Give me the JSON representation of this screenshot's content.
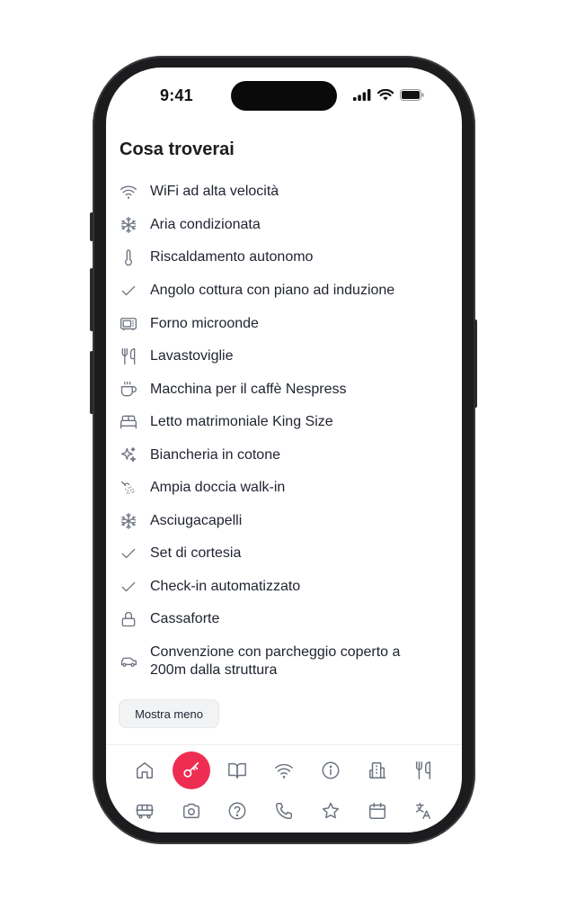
{
  "status_bar": {
    "time": "9:41"
  },
  "section": {
    "title": "Cosa troverai",
    "amenities": [
      {
        "icon": "wifi-icon",
        "label": "WiFi ad alta velocità"
      },
      {
        "icon": "snowflake-icon",
        "label": "Aria condizionata"
      },
      {
        "icon": "thermometer-icon",
        "label": "Riscaldamento autonomo"
      },
      {
        "icon": "check-icon",
        "label": "Angolo cottura con piano ad induzione"
      },
      {
        "icon": "microwave-icon",
        "label": "Forno microonde"
      },
      {
        "icon": "utensils-icon",
        "label": "Lavastoviglie"
      },
      {
        "icon": "coffee-cup-icon",
        "label": "Macchina per il caffè Nespress"
      },
      {
        "icon": "bed-icon",
        "label": "Letto matrimoniale King Size"
      },
      {
        "icon": "sparkles-icon",
        "label": "Biancheria in cotone"
      },
      {
        "icon": "shower-icon",
        "label": "Ampia doccia walk-in"
      },
      {
        "icon": "snowflake-icon",
        "label": "Asciugacapelli"
      },
      {
        "icon": "check-icon",
        "label": "Set di cortesia"
      },
      {
        "icon": "check-icon",
        "label": "Check-in automatizzato"
      },
      {
        "icon": "lock-icon",
        "label": "Cassaforte"
      },
      {
        "icon": "car-icon",
        "label": "Convenzione con parcheggio coperto a 200m dalla struttura"
      }
    ],
    "toggle_label": "Mostra meno"
  },
  "bottom_nav": {
    "row1": [
      "home-icon",
      "key-icon",
      "book-open-icon",
      "wifi-icon",
      "info-icon",
      "building-icon",
      "utensils-icon"
    ],
    "row2": [
      "bus-icon",
      "camera-icon",
      "help-circle-icon",
      "phone-icon",
      "star-icon",
      "calendar-icon",
      "translate-icon"
    ],
    "active": "key-icon"
  },
  "colors": {
    "accent": "#ef2d52",
    "text": "#1f2330",
    "icon": "#6b7280",
    "button_bg": "#f1f3f5"
  }
}
